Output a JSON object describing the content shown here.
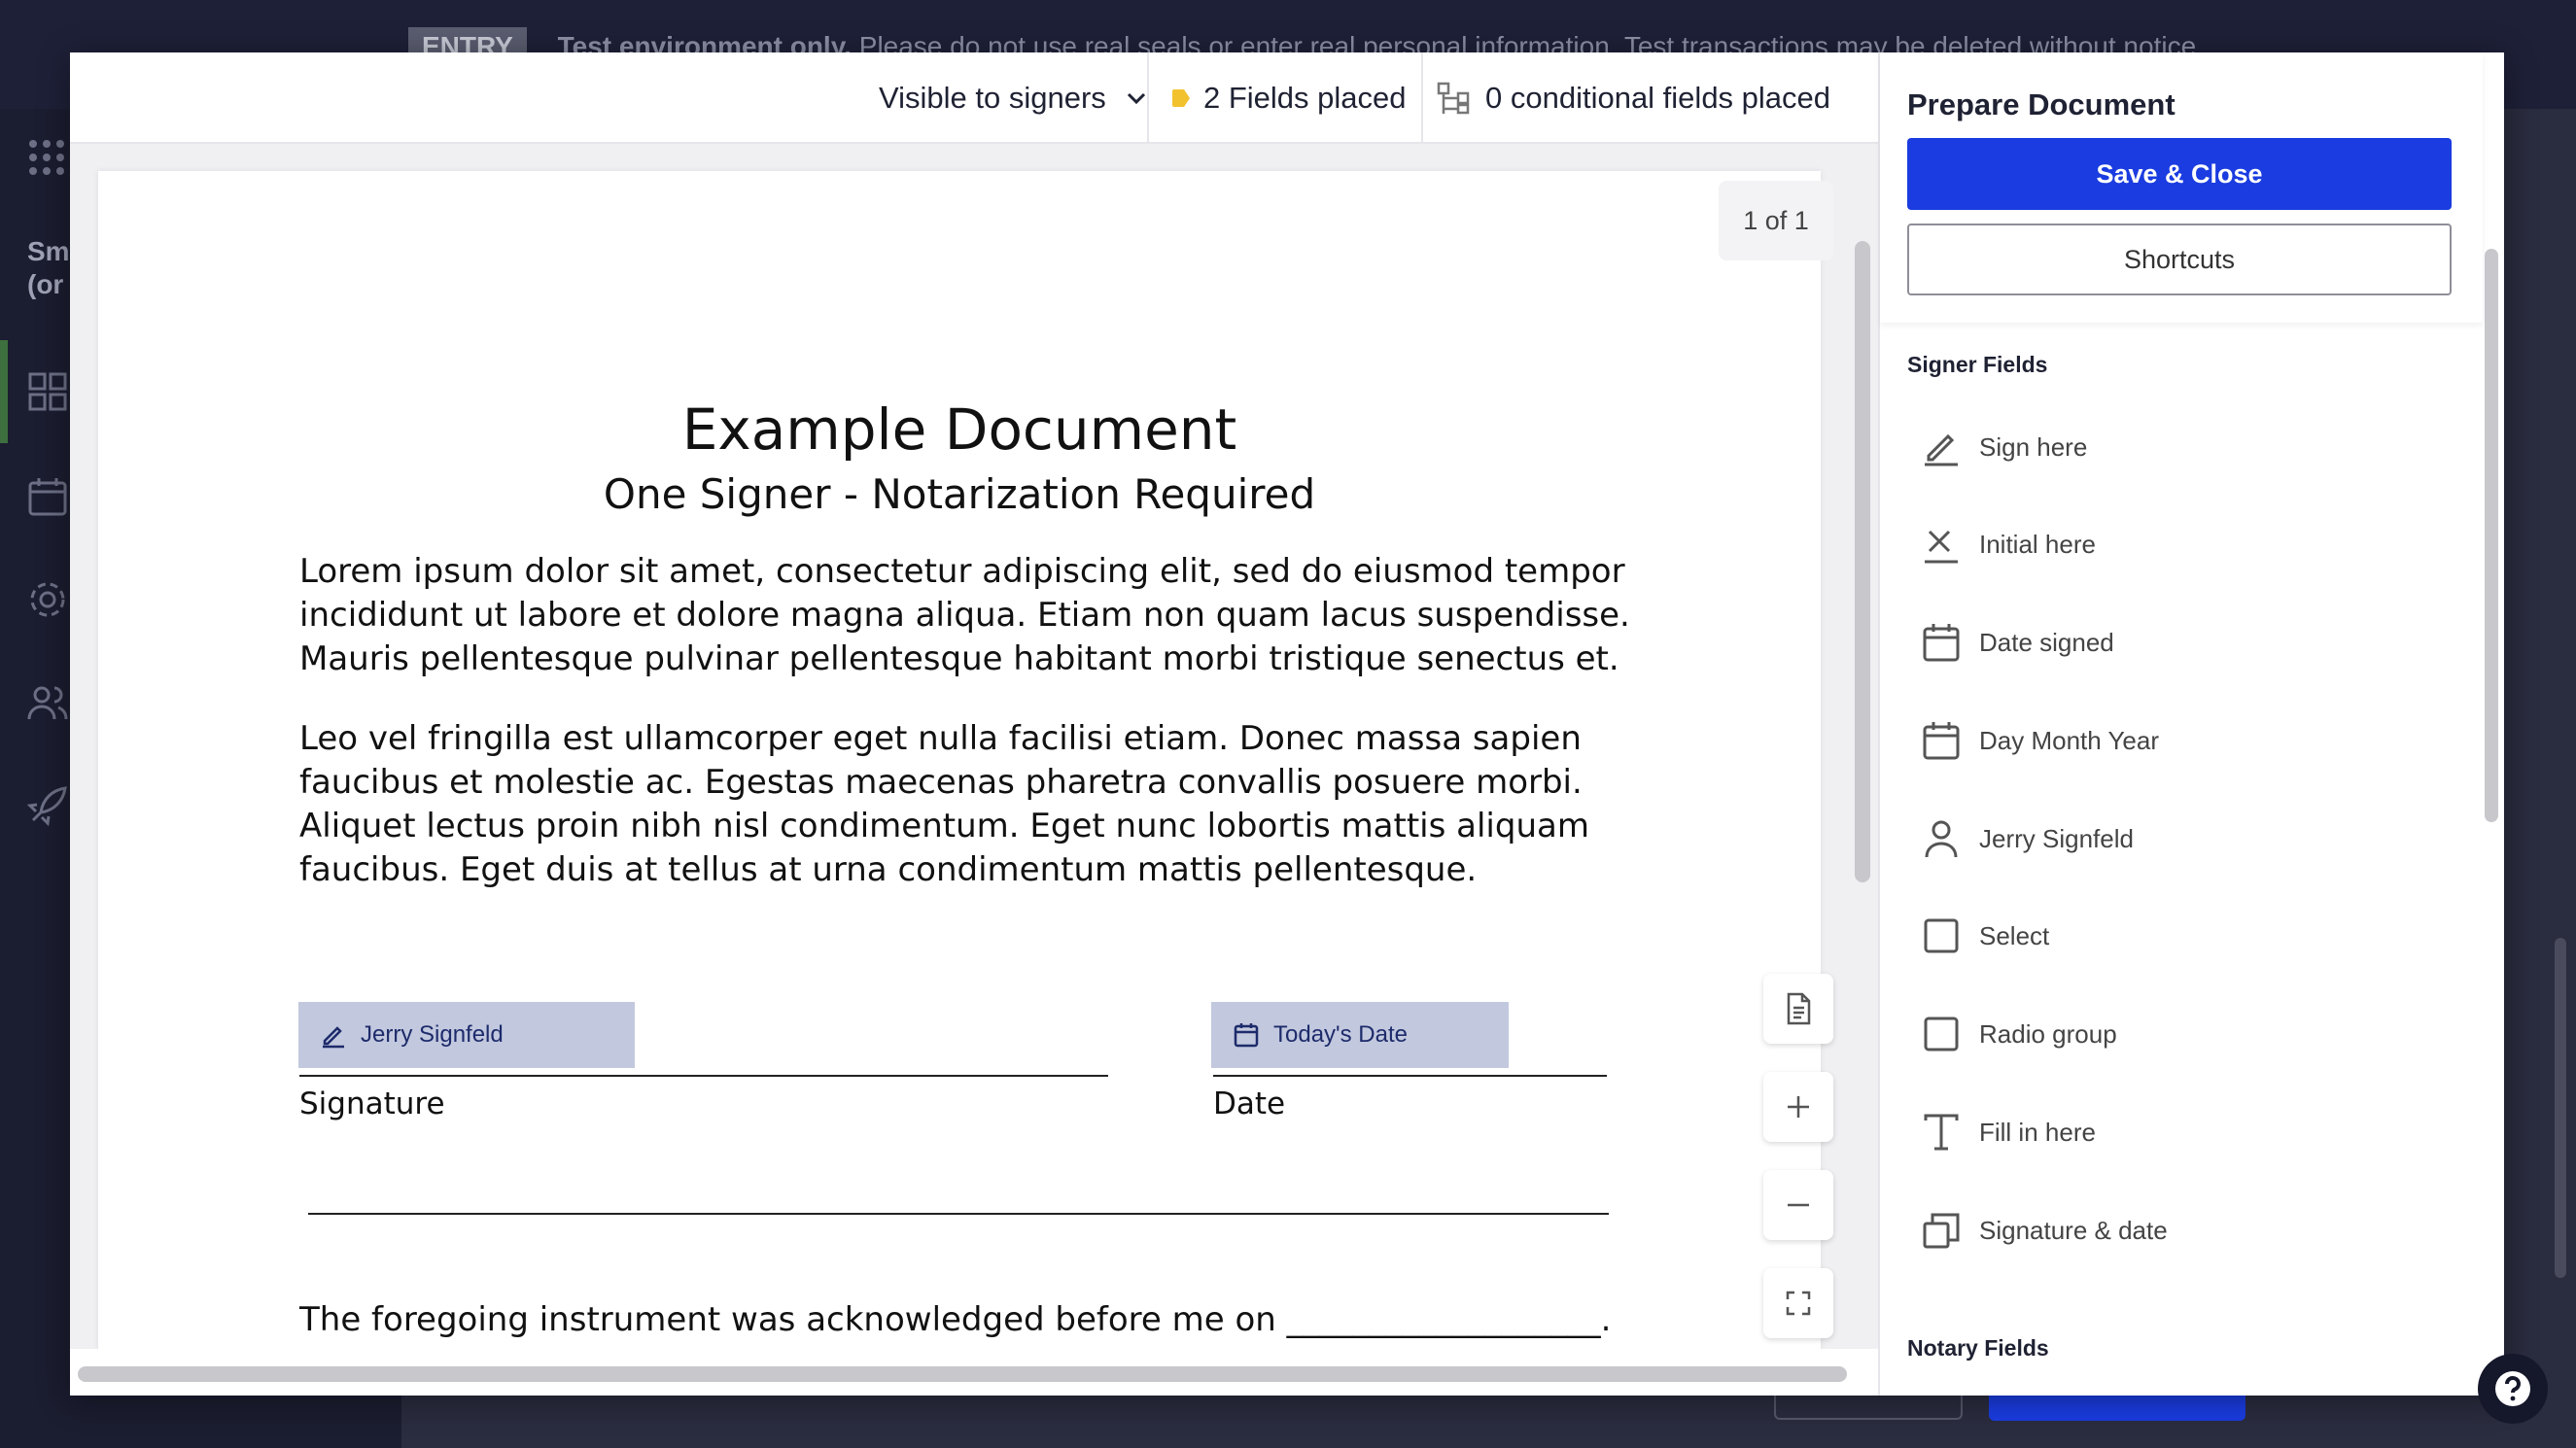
{
  "background": {
    "banner_tag": "ENTRY",
    "banner_bold": "Test environment only.",
    "banner_text": "Please do not use real seals or enter real personal information. Test transactions may be deleted without notice.",
    "brand": "Sm\n(or"
  },
  "toolbar": {
    "visibility_label": "Visible to signers",
    "fields_placed": "2 Fields placed",
    "conditional_fields": "0 conditional fields placed"
  },
  "document": {
    "page_counter": "1 of 1",
    "title": "Example Document",
    "subtitle": "One Signer - Notarization Required",
    "paragraph1": "Lorem ipsum dolor sit amet, consectetur adipiscing elit, sed do eiusmod tempor incididunt ut labore et dolore magna aliqua. Etiam non quam lacus suspendisse. Mauris pellentesque pulvinar pellentesque habitant morbi tristique senectus et.",
    "paragraph2": "Leo vel fringilla est ullamcorper eget nulla facilisi etiam. Donec massa sapien faucibus et molestie ac. Egestas maecenas pharetra convallis posuere morbi. Aliquet lectus proin nibh nisl condimentum. Eget nunc lobortis mattis aliquam faucibus. Eget duis at tellus at urna condimentum mattis pellentesque.",
    "signature_field": "Jerry Signfeld",
    "date_field": "Today's Date",
    "signature_label": "Signature",
    "date_label": "Date",
    "acknowledgement": "The foregoing instrument was acknowledged before me on ___________________."
  },
  "panel": {
    "title": "Prepare Document",
    "save_label": "Save & Close",
    "shortcuts_label": "Shortcuts",
    "signer_fields_title": "Signer Fields",
    "signer_fields": [
      {
        "label": "Sign here",
        "icon": "pen-icon"
      },
      {
        "label": "Initial here",
        "icon": "initial-x-icon"
      },
      {
        "label": "Date signed",
        "icon": "calendar-icon"
      },
      {
        "label": "Day Month Year",
        "icon": "calendar-icon"
      },
      {
        "label": "Jerry Signfeld",
        "icon": "person-icon"
      },
      {
        "label": "Select",
        "icon": "checkbox-icon"
      },
      {
        "label": "Radio group",
        "icon": "checkbox-icon"
      },
      {
        "label": "Fill in here",
        "icon": "text-t-icon"
      },
      {
        "label": "Signature & date",
        "icon": "stacked-squares-icon"
      }
    ],
    "notary_fields_title": "Notary Fields"
  },
  "colors": {
    "primary": "#1a3ce0",
    "field_chip": "#c2c8de",
    "fields_dot": "#f2c12e"
  }
}
